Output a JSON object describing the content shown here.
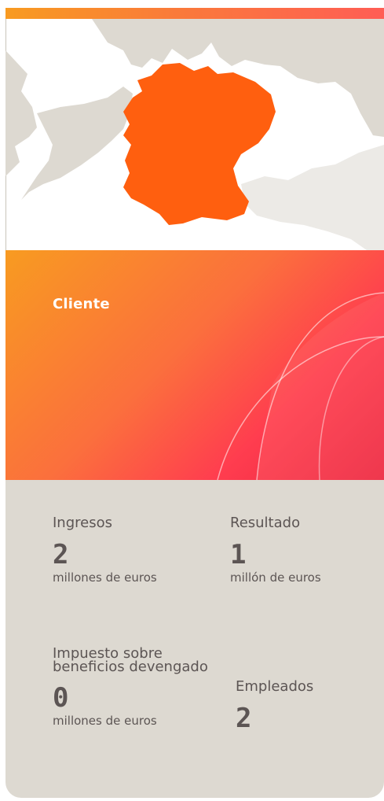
{
  "header": {
    "accent_gradient": [
      "#f89b21",
      "#ff5d55"
    ]
  },
  "map": {
    "highlighted_country_color": "#ff5f0f",
    "land_color": "#ddd9d1"
  },
  "client": {
    "label": "Cliente"
  },
  "stats": {
    "ingresos": {
      "label": "Ingresos",
      "value": "2",
      "unit": "millones de euros"
    },
    "resultado": {
      "label": "Resultado",
      "value": "1",
      "unit": "millón de euros"
    },
    "impuesto": {
      "label": "Impuesto sobre beneficios devengado",
      "value": "0",
      "unit": "millones de euros"
    },
    "empleados": {
      "label": "Empleados",
      "value": "2"
    }
  },
  "colors": {
    "stats_background": "#ddd9d1",
    "stats_text": "#5c5554"
  }
}
